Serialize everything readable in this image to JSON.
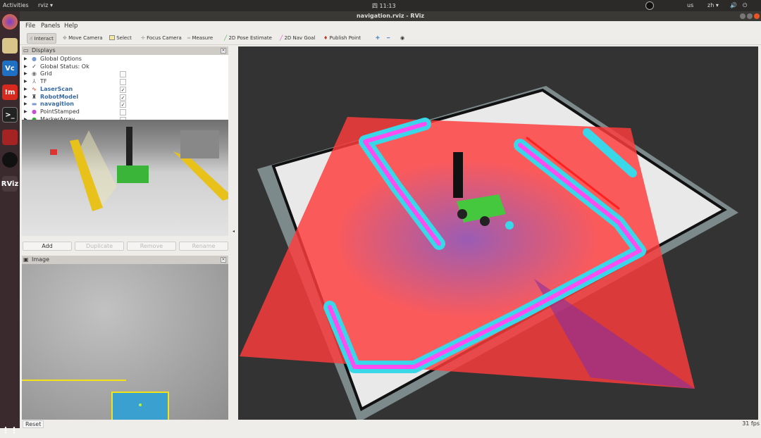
{
  "system_bar": {
    "activities": "Activities",
    "app": "rviz ▾",
    "clock": "四 11:13",
    "keyboard": "us",
    "lang": "zh ▾"
  },
  "window": {
    "title": "navigation.rviz - RViz"
  },
  "menu": [
    "File",
    "Panels",
    "Help"
  ],
  "toolbar": [
    {
      "label": "Interact",
      "icon": "cursor-icon",
      "active": true
    },
    {
      "label": "Move Camera",
      "icon": "move-icon"
    },
    {
      "label": "Select",
      "icon": "select-box-icon"
    },
    {
      "label": "Focus Camera",
      "icon": "focus-icon"
    },
    {
      "label": "Measure",
      "icon": "ruler-icon"
    },
    {
      "label": "2D Pose Estimate",
      "icon": "green-arrow-icon",
      "color": "#3cb043"
    },
    {
      "label": "2D Nav Goal",
      "icon": "pink-arrow-icon",
      "color": "#d94fc8"
    },
    {
      "label": "Publish Point",
      "icon": "map-pin-icon",
      "color": "#c0392b"
    }
  ],
  "displays": {
    "title": "Displays",
    "items": [
      {
        "label": "Global Options",
        "icon": "globe-icon",
        "checkbox": null
      },
      {
        "label": "Global Status: Ok",
        "icon": "check-icon",
        "checkbox": null
      },
      {
        "label": "Grid",
        "icon": "grid-icon",
        "checkbox": false
      },
      {
        "label": "TF",
        "icon": "tf-icon",
        "checkbox": false
      },
      {
        "label": "LaserScan",
        "icon": "laser-icon",
        "checkbox": true,
        "highlight": true
      },
      {
        "label": "RobotModel",
        "icon": "robot-icon",
        "checkbox": true,
        "highlight": true
      },
      {
        "label": "navagition",
        "icon": "folder-icon",
        "checkbox": true,
        "highlight": true
      },
      {
        "label": "PointStamped",
        "icon": "point-icon",
        "checkbox": false
      },
      {
        "label": "MarkerArray",
        "icon": "marker-icon",
        "checkbox": false
      }
    ],
    "buttons": {
      "add": "Add",
      "duplicate": "Duplicate",
      "remove": "Remove",
      "rename": "Rename"
    }
  },
  "image_panel": {
    "title": "Image"
  },
  "status": {
    "reset": "Reset",
    "fps": "31 fps"
  },
  "colors": {
    "costmap_red": "#ff3b3b",
    "costmap_purple": "#8a2ea0",
    "inflation_cyan": "#3ad7e8",
    "obstacle_magenta": "#ff4cf0"
  }
}
